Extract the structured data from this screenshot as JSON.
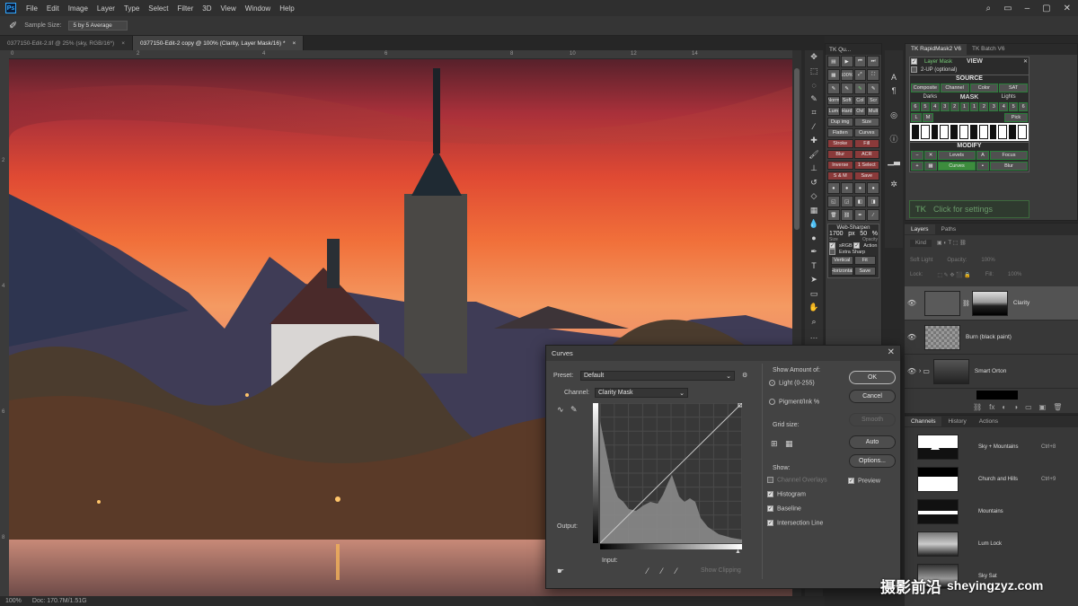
{
  "menubar": {
    "items": [
      "File",
      "Edit",
      "Image",
      "Layer",
      "Type",
      "Select",
      "Filter",
      "3D",
      "View",
      "Window",
      "Help"
    ],
    "logo": "Ps"
  },
  "options": {
    "sample_size_label": "Sample Size:",
    "sample_size_value": "5 by 5 Average"
  },
  "doc_tabs": [
    {
      "label": "0377150-Edit-2.tif @ 25% (sky, RGB/16*)",
      "close": "×"
    },
    {
      "label": "0377150-Edit-2 copy @ 100% (Clarity, Layer Mask/16) *",
      "close": "×"
    }
  ],
  "ruler": {
    "top": [
      "0",
      "2",
      "4",
      "6",
      "8",
      "10",
      "12",
      "14"
    ],
    "left": [
      "2",
      "4",
      "6",
      "8"
    ]
  },
  "status": {
    "zoom": "100%",
    "doc": "Doc: 170.7M/1.51G"
  },
  "tk_quick": {
    "title": "TK Qu...",
    "rows": [
      [
        "Norm",
        "Soft",
        "Col",
        "Scr"
      ],
      [
        "Lum",
        "Hard",
        "Ovl",
        "Mult"
      ],
      [
        "Dup img",
        "Size"
      ],
      [
        "Flatten",
        "Curves"
      ],
      [
        "Stroke",
        "Fill"
      ],
      [
        "Blur",
        "ACR"
      ],
      [
        "Inverse",
        "1 Select"
      ],
      [
        "S & M",
        "Save"
      ]
    ],
    "ws_title": "Web-Sharpen",
    "ws_size": "1700",
    "ws_unit": "px",
    "ws_opacity": "50",
    "ws_pct": "%",
    "ws_size_lbl": "Size",
    "ws_opacity_lbl": "Opacity",
    "ws_srgb": "sRGB",
    "ws_action": "Action",
    "ws_extra": "Extra Sharp",
    "ws_vertical": "Vertical",
    "ws_fit": "Fit",
    "ws_horizontal": "Horizontal",
    "ws_save": "Save",
    "zoom": "100%"
  },
  "rapid": {
    "tabs": [
      "TK RapidMask2 V6",
      "TK Batch V6"
    ],
    "layer_mask": "Layer Mask",
    "view": "VIEW",
    "twoup": "2-UP (optional)",
    "source": "SOURCE",
    "source_btns": [
      "Composite",
      "Channel",
      "Color",
      "SAT"
    ],
    "darks": "Darks",
    "mask": "MASK",
    "lights": "Lights",
    "mask_nums": [
      "6",
      "5",
      "4",
      "3",
      "2",
      "1",
      "1",
      "2",
      "3",
      "4",
      "5",
      "6"
    ],
    "pick": "Pick",
    "modify": "MODIFY",
    "modify_row1": [
      "Levels",
      "Focus"
    ],
    "modify_row2": [
      "Curves",
      "Blur"
    ],
    "settings": "Click for settings",
    "tk": "TK"
  },
  "layers": {
    "tabs": [
      "Layers",
      "Paths"
    ],
    "kind": "Kind",
    "blend": "Soft Light",
    "opacity_lbl": "Opacity:",
    "opacity": "100%",
    "lock_lbl": "Lock:",
    "fill_lbl": "Fill:",
    "fill": "100%",
    "items": [
      {
        "name": "Clarity"
      },
      {
        "name": "Burn (black paint)"
      },
      {
        "name": "Smart Orton"
      }
    ]
  },
  "channels": {
    "tabs": [
      "Channels",
      "History",
      "Actions"
    ],
    "items": [
      {
        "name": "Sky + Mountains",
        "key": "Ctrl+8"
      },
      {
        "name": "Church and Hills",
        "key": "Ctrl+9"
      },
      {
        "name": "Mountains",
        "key": ""
      },
      {
        "name": "Lum Lock",
        "key": ""
      },
      {
        "name": "Sky Sat",
        "key": ""
      }
    ]
  },
  "curves": {
    "title": "Curves",
    "preset_lbl": "Preset:",
    "preset": "Default",
    "channel_lbl": "Channel:",
    "channel": "Clarity Mask",
    "output_lbl": "Output:",
    "input_lbl": "Input:",
    "show_clipping": "Show Clipping",
    "show_amount": "Show Amount of:",
    "light": "Light (0-255)",
    "pigment": "Pigment/Ink %",
    "grid_size": "Grid size:",
    "show": "Show:",
    "channel_overlays": "Channel Overlays",
    "histogram": "Histogram",
    "baseline": "Baseline",
    "intersection": "Intersection Line",
    "ok": "OK",
    "cancel": "Cancel",
    "smooth": "Smooth",
    "auto": "Auto",
    "options": "Options...",
    "preview": "Preview"
  },
  "watermark": {
    "cn": "摄影前沿",
    "url": "sheyingzyz.com"
  }
}
